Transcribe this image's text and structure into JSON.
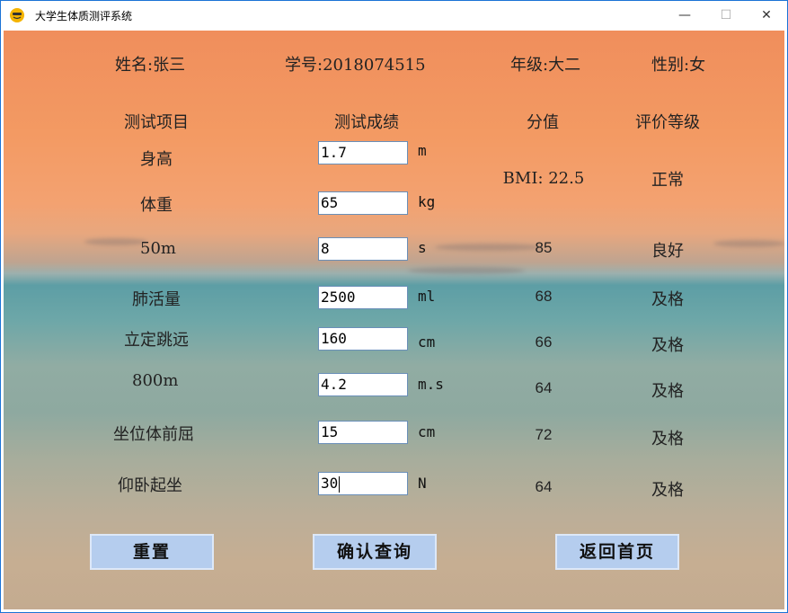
{
  "window": {
    "title": "大学生体质测评系统",
    "icon": "app-logo-icon",
    "minimize": "—",
    "maximize": "☐",
    "close": "✕"
  },
  "student": {
    "name": "姓名:张三",
    "student_id": "学号:2018074515",
    "grade": "年级:大二",
    "gender": "性别:女"
  },
  "headers": {
    "item": "测试项目",
    "result": "测试成绩",
    "score": "分值",
    "rating": "评价等级"
  },
  "rows": [
    {
      "item": "身高",
      "value": "1.7",
      "unit": "m"
    },
    {
      "item": "体重",
      "value": "65",
      "unit": "kg"
    },
    {
      "item": "50m",
      "value": "8",
      "unit": "s",
      "score": "85",
      "rating": "良好"
    },
    {
      "item": "肺活量",
      "value": "2500",
      "unit": "ml",
      "score": "68",
      "rating": "及格"
    },
    {
      "item": "立定跳远",
      "value": "160",
      "unit": "cm",
      "score": "66",
      "rating": "及格"
    },
    {
      "item": "800m",
      "value": "4.2",
      "unit": "m.s",
      "score": "64",
      "rating": "及格"
    },
    {
      "item": "坐位体前屈",
      "value": "15",
      "unit": "cm",
      "score": "72",
      "rating": "及格"
    },
    {
      "item": "仰卧起坐",
      "value": "30",
      "unit": "N",
      "score": "64",
      "rating": "及格"
    }
  ],
  "bmi": {
    "score": "BMI: 22.5",
    "rating": "正常"
  },
  "buttons": {
    "reset": "重置",
    "confirm": "确认查询",
    "home": "返回首页"
  }
}
